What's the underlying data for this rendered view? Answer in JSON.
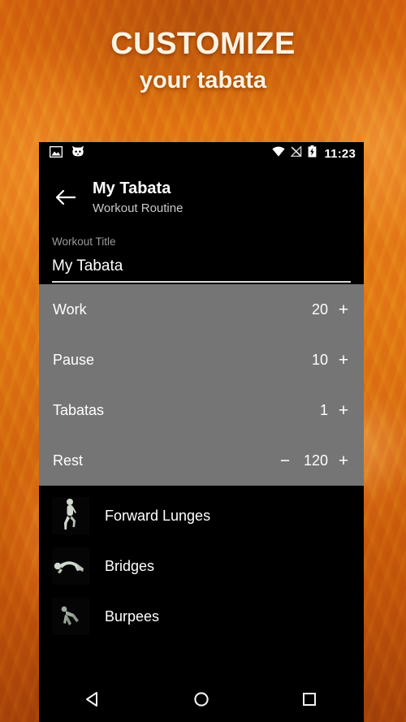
{
  "promo": {
    "headline_line1": "CUSTOMIZE",
    "headline_line2": "your tabata",
    "headline_color": "#fdf3e2",
    "background_color": "#e0780f"
  },
  "status_bar": {
    "icons_left": [
      "image-icon",
      "cat-notification-icon"
    ],
    "icons_right": [
      "wifi-icon",
      "no-signal-icon",
      "battery-charging-icon"
    ],
    "time": "11:23"
  },
  "app_bar": {
    "back_icon": "back-arrow-icon",
    "title": "My Tabata",
    "subtitle": "Workout Routine"
  },
  "title_field": {
    "label": "Workout Title",
    "value": "My Tabata",
    "placeholder": "Workout Title"
  },
  "settings": {
    "panel_color": "#757575",
    "rows": [
      {
        "label": "Work",
        "value": "20",
        "minus": "",
        "plus": "+"
      },
      {
        "label": "Pause",
        "value": "10",
        "minus": "",
        "plus": "+"
      },
      {
        "label": "Tabatas",
        "value": "1",
        "minus": "",
        "plus": "+"
      },
      {
        "label": "Rest",
        "value": "120",
        "minus": "−",
        "plus": "+"
      }
    ]
  },
  "exercises": {
    "items": [
      {
        "name": "Forward Lunges",
        "thumb": "lunge-figure-thumbnail"
      },
      {
        "name": "Bridges",
        "thumb": "bridge-figure-thumbnail"
      },
      {
        "name": "Burpees",
        "thumb": "burpee-figure-thumbnail"
      }
    ]
  },
  "nav_bar": {
    "back": "nav-back-icon",
    "home": "nav-home-icon",
    "recents": "nav-recents-icon"
  }
}
